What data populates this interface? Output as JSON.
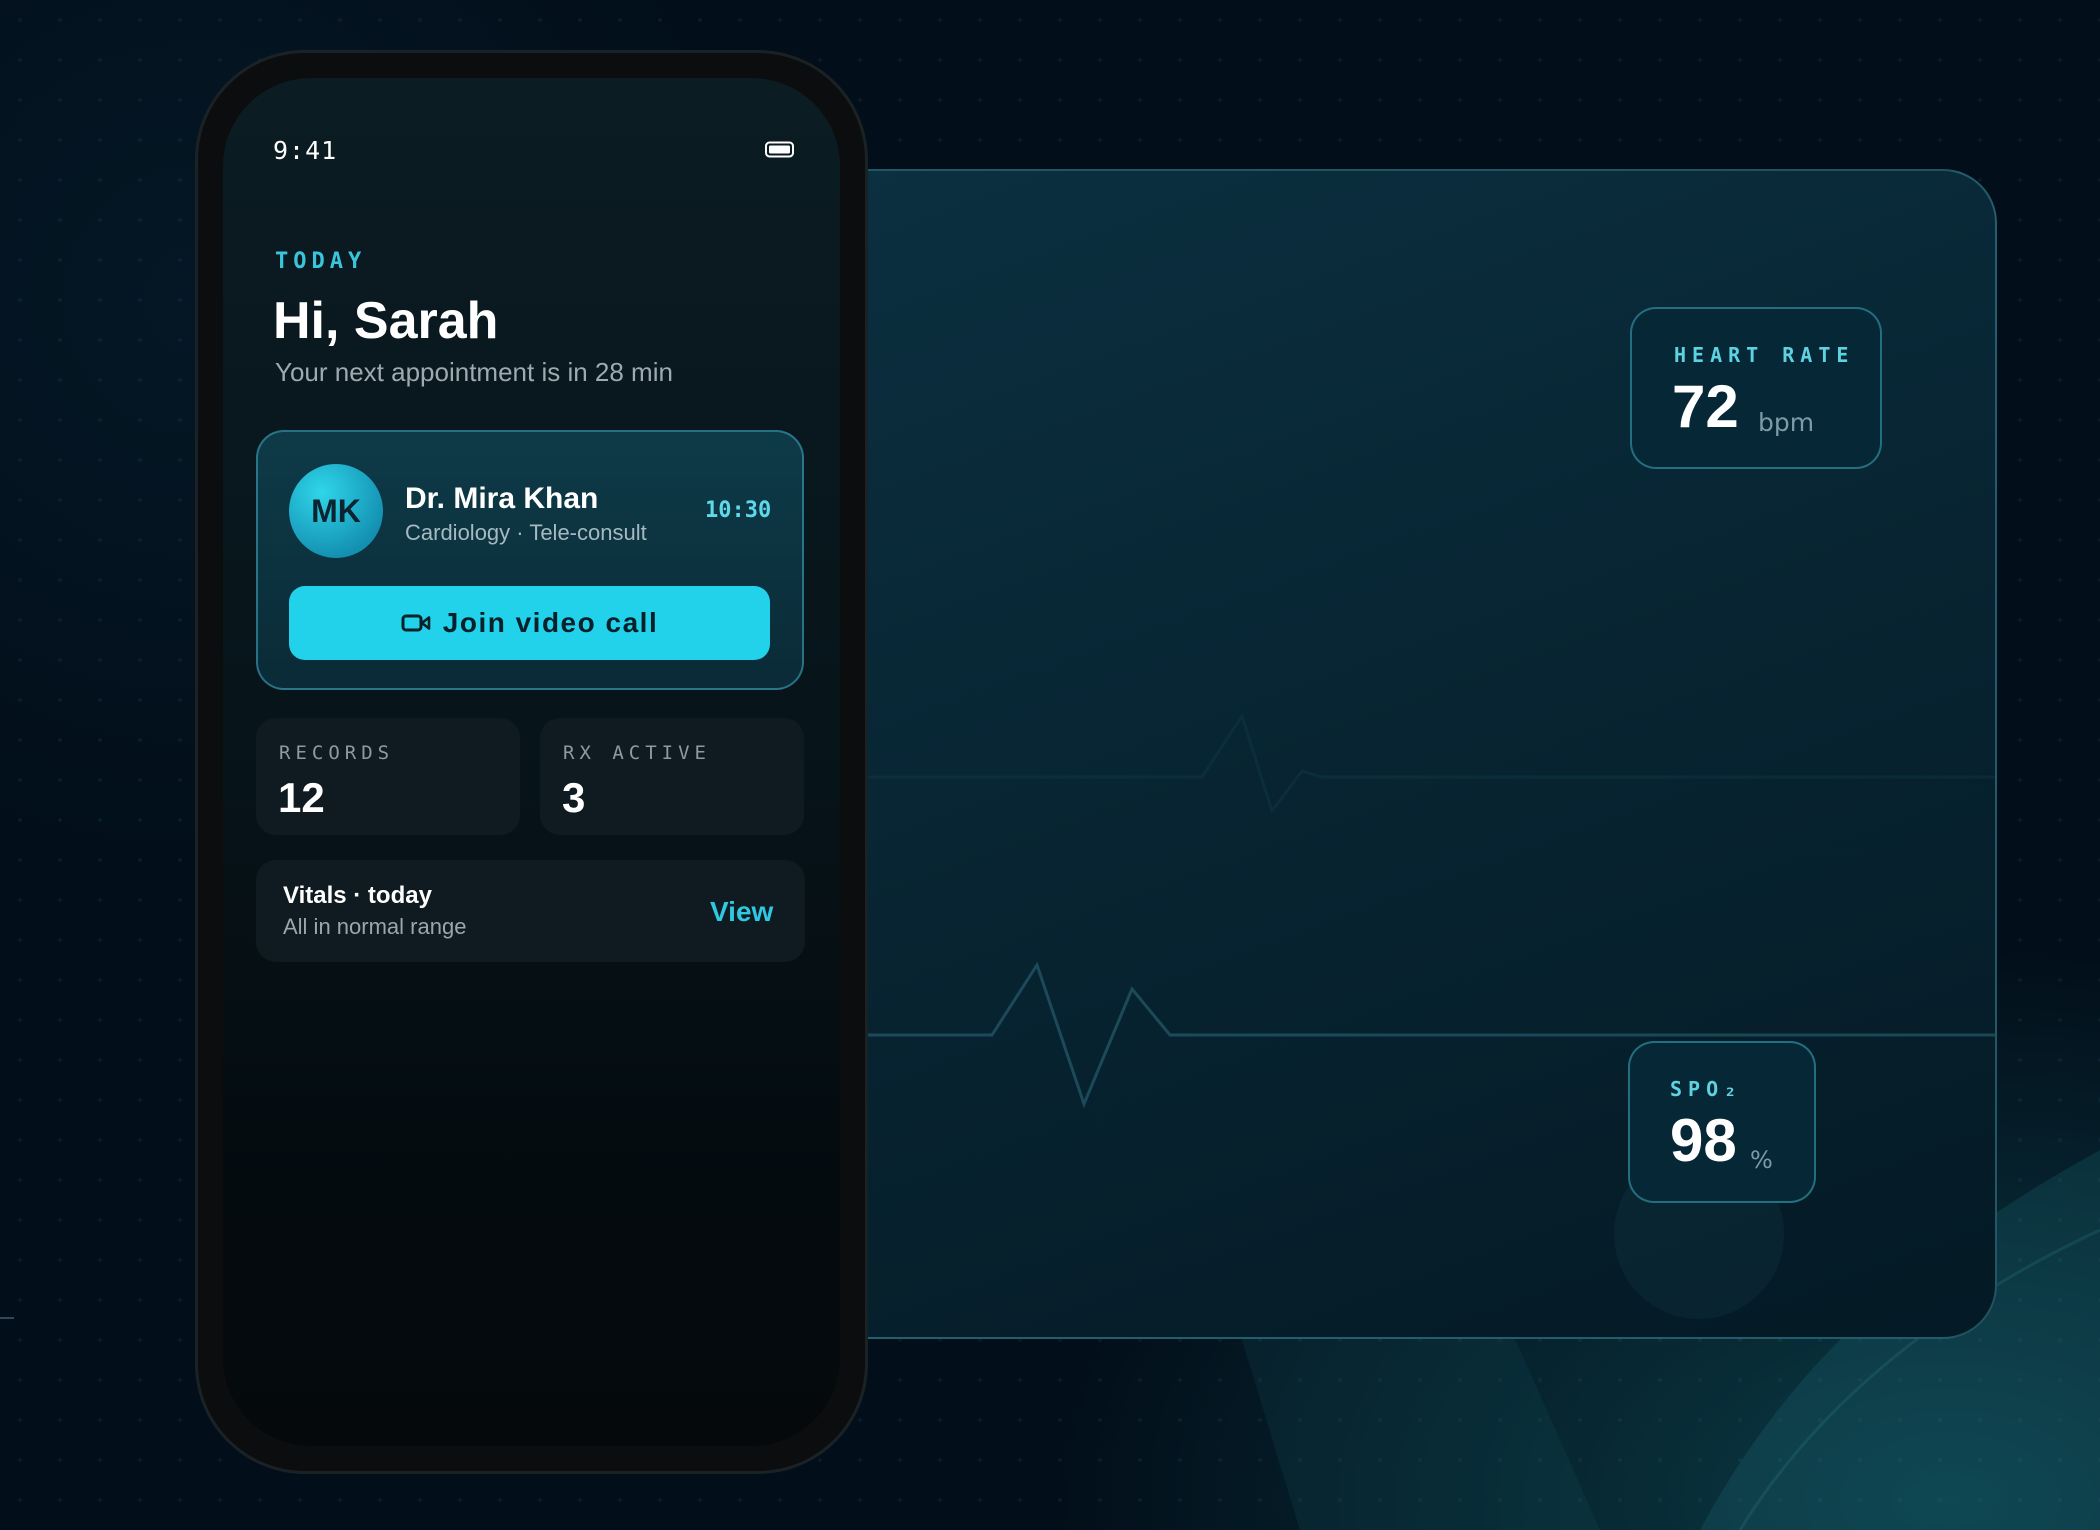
{
  "status_bar": {
    "time": "9:41",
    "battery_icon": "battery-icon"
  },
  "home": {
    "eyebrow": "TODAY",
    "greeting": "Hi, Sarah",
    "subtitle": "Your next appointment is in 28 min"
  },
  "appointment": {
    "avatar_initials": "MK",
    "doctor_name": "Dr. Mira Khan",
    "specialty": "Cardiology · Tele-consult",
    "time": "10:30",
    "join_label": "Join video call",
    "join_icon": "video-camera-icon"
  },
  "stats": [
    {
      "label": "RECORDS",
      "value": "12"
    },
    {
      "label": "RX ACTIVE",
      "value": "3"
    }
  ],
  "vitals": {
    "title": "Vitals · today",
    "subtitle": "All in normal range",
    "action": "View"
  },
  "heart_rate": {
    "label": "HEART RATE",
    "value": "72",
    "unit": "bpm"
  },
  "spo2": {
    "label": "SPO₂",
    "value": "98",
    "unit": "%"
  },
  "colors": {
    "accent": "#22d2ea",
    "background": "#020e19",
    "card": "#0f1b20",
    "accent_text": "#2ec8e2"
  }
}
